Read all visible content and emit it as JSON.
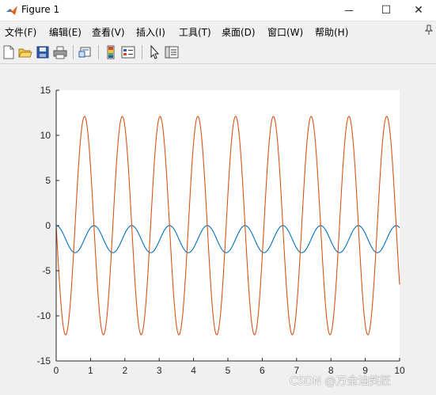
{
  "window": {
    "title": "Figure 1",
    "minimize_glyph": "—",
    "maximize_glyph": "☐",
    "close_glyph": "✕"
  },
  "menu": [
    {
      "id": "file",
      "label": "文件(F)"
    },
    {
      "id": "edit",
      "label": "编辑(E)"
    },
    {
      "id": "view",
      "label": "查看(V)"
    },
    {
      "id": "insert",
      "label": "插入(I)"
    },
    {
      "id": "tools",
      "label": "工具(T)"
    },
    {
      "id": "desktop",
      "label": "桌面(D)"
    },
    {
      "id": "window",
      "label": "窗口(W)"
    },
    {
      "id": "help",
      "label": "帮助(H)"
    }
  ],
  "toolbar": [
    {
      "name": "new-figure-icon"
    },
    {
      "name": "open-file-icon"
    },
    {
      "name": "save-figure-icon"
    },
    {
      "name": "print-figure-icon"
    },
    {
      "name": "link-plot-icon"
    },
    {
      "name": "insert-colorbar-icon"
    },
    {
      "name": "insert-legend-icon"
    },
    {
      "name": "edit-plot-icon"
    },
    {
      "name": "property-inspector-icon"
    }
  ],
  "chart_data": {
    "type": "line",
    "xlim": [
      0,
      10
    ],
    "ylim": [
      -15,
      15
    ],
    "xticks": [
      "0",
      "1",
      "2",
      "3",
      "4",
      "5",
      "6",
      "7",
      "8",
      "9",
      "10"
    ],
    "yticks": [
      "15",
      "10",
      "5",
      "0",
      "-5",
      "-10",
      "-15"
    ],
    "grid": false,
    "series": [
      {
        "color": "#0072BD",
        "formula": "y = -1.5*(1 - cos(2*pi*x/1.1))",
        "peak_max": 0,
        "peak_min": -3.0,
        "period": 1.1
      },
      {
        "color": "#D95319",
        "formula": "y = -12*cos(2*pi*x/1.1) after starting near 0",
        "peak_max": 12.1,
        "peak_min": -12.1,
        "period": 1.1
      }
    ]
  },
  "watermark": "CSDN @万金油笑匠"
}
